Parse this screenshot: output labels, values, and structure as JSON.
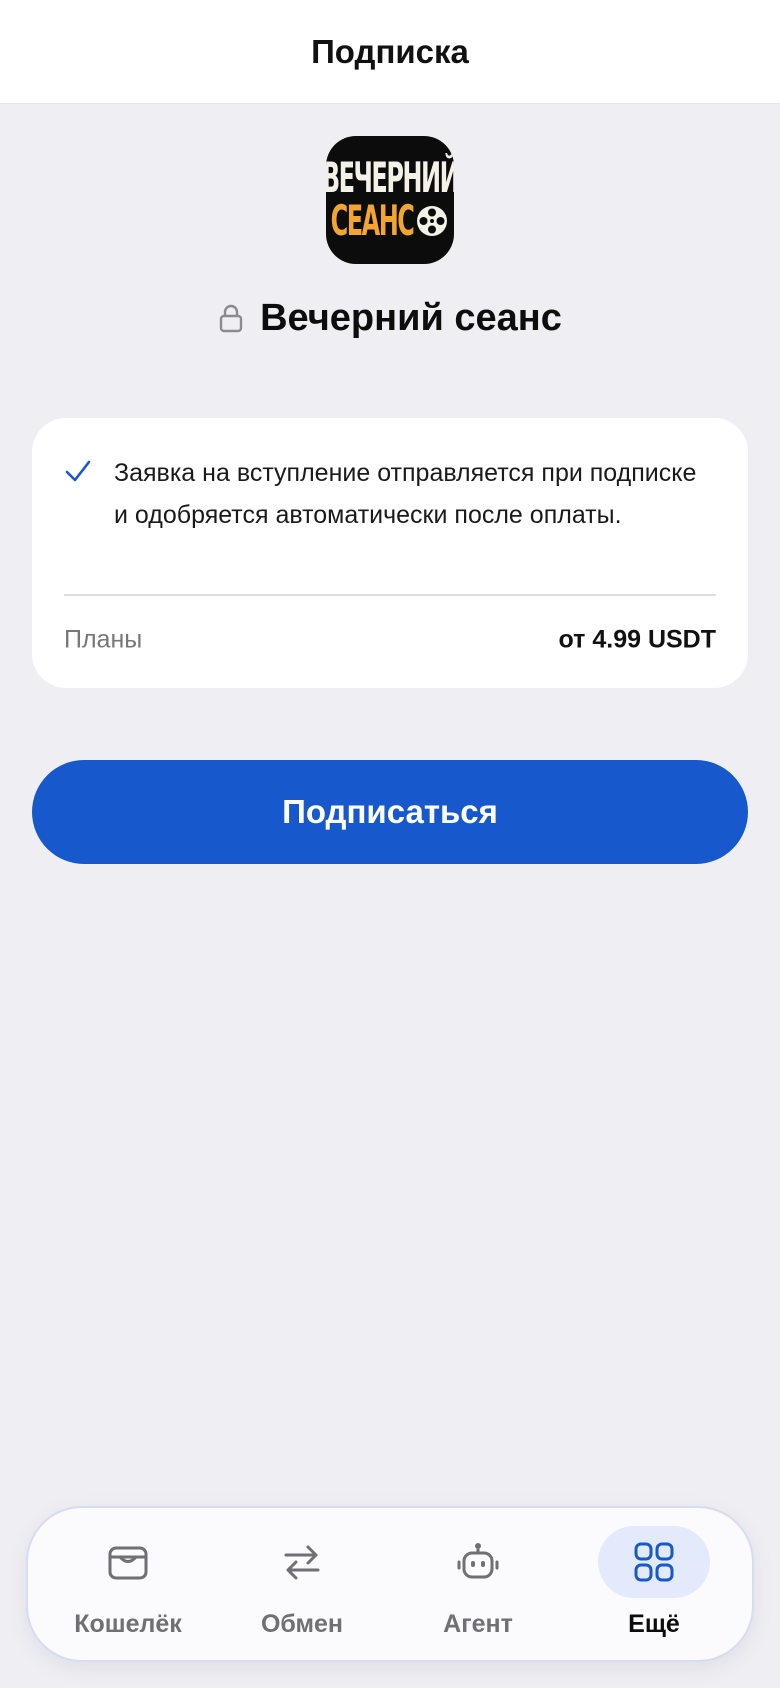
{
  "header": {
    "title": "Подписка"
  },
  "channel": {
    "logo_line1": "ВЕЧЕРНИЙ",
    "logo_line2": "СЕАНС",
    "name": "Вечерний сеанс",
    "private": true
  },
  "info": {
    "note": "Заявка на вступление отправляется при подписке и одобряется автоматически после оплаты.",
    "plans_label": "Планы",
    "plans_value": "от 4.99 USDT"
  },
  "subscribe_button": {
    "label": "Подписаться"
  },
  "tabbar": {
    "items": [
      {
        "label": "Кошелёк",
        "icon": "wallet-icon",
        "active": false
      },
      {
        "label": "Обмен",
        "icon": "swap-arrows-icon",
        "active": false
      },
      {
        "label": "Агент",
        "icon": "robot-icon",
        "active": false
      },
      {
        "label": "Ещё",
        "icon": "grid-icon",
        "active": true
      }
    ]
  },
  "colors": {
    "accent": "#1759cc",
    "background": "#efeff3",
    "logo_orange": "#f2a531",
    "active_tab_bg": "#e2eafb"
  }
}
